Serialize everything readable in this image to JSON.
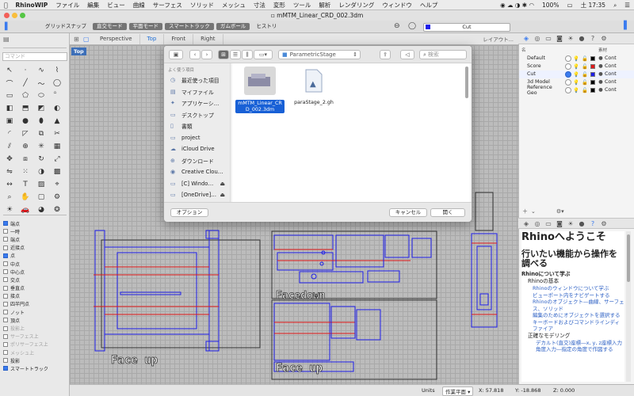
{
  "menubar": {
    "app": "RhinoWIP",
    "items": [
      "ファイル",
      "編集",
      "ビュー",
      "曲線",
      "サーフェス",
      "ソリッド",
      "メッシュ",
      "寸法",
      "変形",
      "ツール",
      "解析",
      "レンダリング",
      "ウィンドウ",
      "ヘルプ"
    ],
    "battery": "100%",
    "time": "土 17:35"
  },
  "titlebar": {
    "title": "mMTM_Linear_CRD_002.3dm"
  },
  "toolbar": {
    "buttons": [
      {
        "label": "グリッドスナップ",
        "on": false
      },
      {
        "label": "直交モード",
        "on": true
      },
      {
        "label": "平面モード",
        "on": true
      },
      {
        "label": "スマートトラック",
        "on": true
      },
      {
        "label": "ガムボール",
        "on": true
      },
      {
        "label": "ヒストリ",
        "on": false
      }
    ],
    "current_layer": "Cut",
    "layer_color": "#1e1ee8"
  },
  "command": {
    "placeholder": "コマンド"
  },
  "viewport": {
    "tabs": [
      "Perspective",
      "Top",
      "Front",
      "Right"
    ],
    "active_tab": "Top",
    "label": "Top",
    "layout_link": "レイアウト...",
    "text_faceup_left": "Face up",
    "text_facedown": "Facedown",
    "text_faceup_right": "Face up"
  },
  "osnap": [
    {
      "label": "端点",
      "on": true
    },
    {
      "label": "一時",
      "on": false
    },
    {
      "label": "端点",
      "on": false
    },
    {
      "label": "近接点",
      "on": false
    },
    {
      "label": "点",
      "on": true
    },
    {
      "label": "中点",
      "on": false
    },
    {
      "label": "中心点",
      "on": false
    },
    {
      "label": "交点",
      "on": false
    },
    {
      "label": "垂直点",
      "on": false
    },
    {
      "label": "接点",
      "on": false
    },
    {
      "label": "四半円点",
      "on": false
    },
    {
      "label": "ノット",
      "on": false
    },
    {
      "label": "頂点",
      "on": false
    },
    {
      "label": "投影上",
      "on": false,
      "dim": true
    },
    {
      "label": "サーフェス上",
      "on": false,
      "dim": true
    },
    {
      "label": "ポリサーフェス上",
      "on": false,
      "dim": true
    },
    {
      "label": "メッシュ上",
      "on": false,
      "dim": true
    },
    {
      "label": "投影",
      "on": false
    },
    {
      "label": "スマートトラック",
      "on": true
    }
  ],
  "dialog": {
    "location": "ParametricStage",
    "search_placeholder": "検索",
    "sidebar_heading": "よく使う項目",
    "sidebar": [
      "最近使った項目",
      "マイファイル",
      "アプリケーシ…",
      "デスクトップ",
      "書類",
      "project",
      "iCloud Drive",
      "ダウンロード",
      "Creative Clou…",
      "[C] Windo…",
      "[OneDrive]…"
    ],
    "files": [
      {
        "name": "mMTM_Linear_CRD_002.3dm",
        "selected": true
      },
      {
        "name": "paraStage_2.gh",
        "selected": false
      }
    ],
    "options_button": "オプション",
    "cancel_button": "キャンセル",
    "open_button": "開く"
  },
  "layers": {
    "header_name": "名",
    "header_material": "素材",
    "rows": [
      {
        "name": "Default",
        "color": "#000000",
        "mat": "Cont"
      },
      {
        "name": "Score",
        "color": "#e01919",
        "mat": "Cont"
      },
      {
        "name": "Cut",
        "color": "#1e1ee8",
        "mat": "Cont"
      },
      {
        "name": "3d Model",
        "color": "#000000",
        "mat": "Cont"
      },
      {
        "name": "Reference Geo",
        "color": "#000000",
        "mat": "Cont"
      }
    ]
  },
  "help": {
    "title": "Rhinoへようこそ",
    "subtitle": "行いたい機能から操作を調べる",
    "about": "Rhinoについて学ぶ",
    "basics_head": "Rhinoの基本",
    "links1": [
      "Rhinoのウィンドウについて学ぶ",
      "ビューポート内をナビゲートする",
      "Rhinoのオブジェクト―曲線、サーフェス、ソリッド",
      "編集のためにオブジェクトを選択する",
      "キーボードおよびコマンドラインディファイア"
    ],
    "modeling_head": "正確なモデリング",
    "links2": [
      "デカルト(直交)座標―x, y, z座標入力",
      "角度入力―指定の角度で作図する"
    ]
  },
  "status": {
    "units_label": "Units",
    "cplane": "作業平面",
    "x": "X: 57.818",
    "y": "Y: -18.868",
    "z": "Z: 0.000"
  }
}
